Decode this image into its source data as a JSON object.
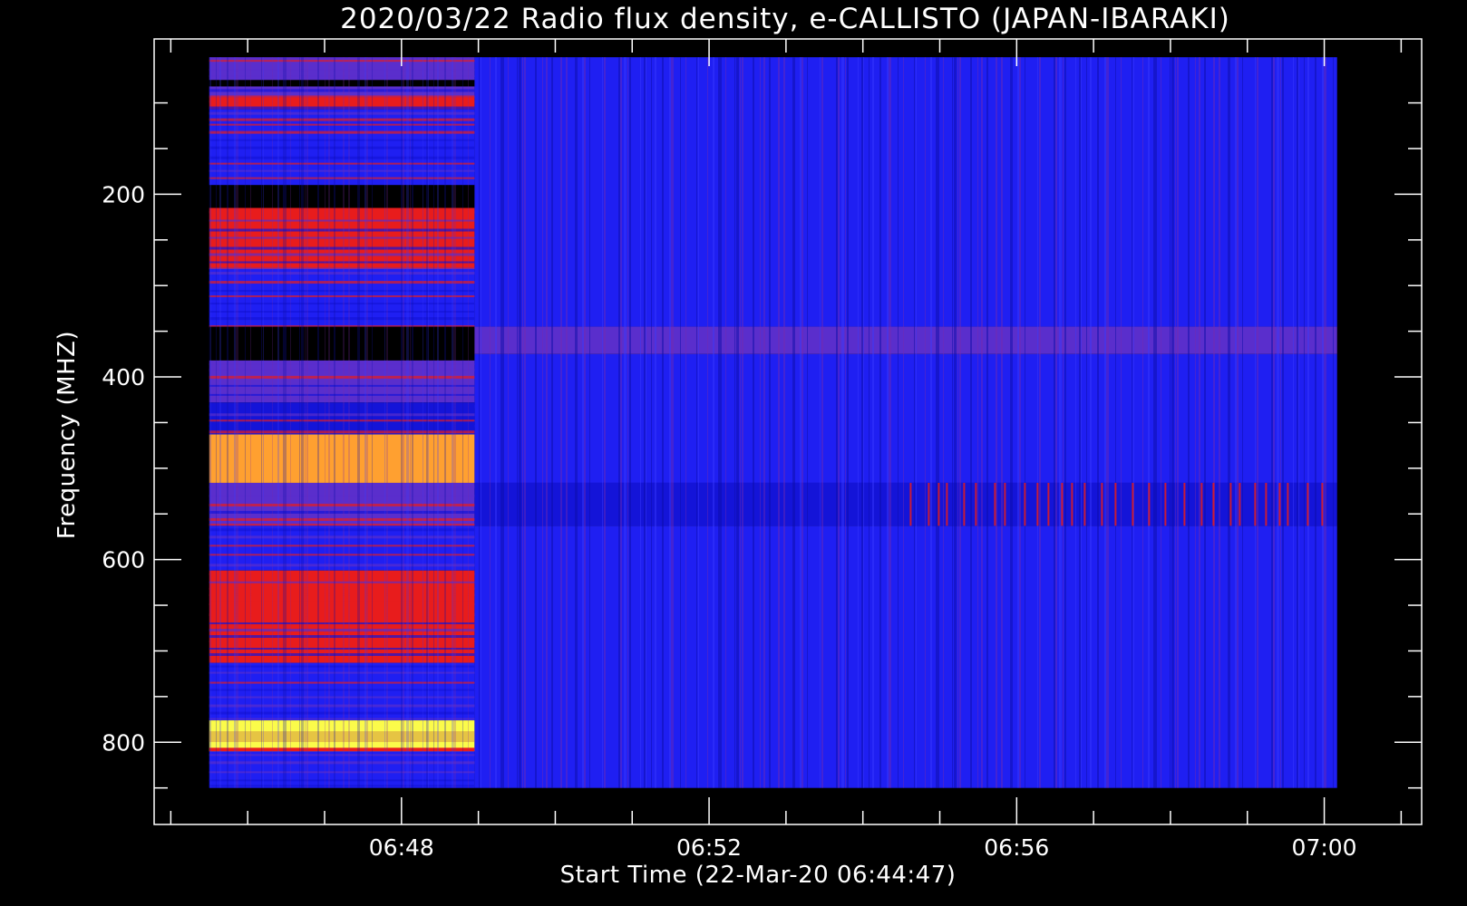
{
  "chart_data": {
    "type": "heatmap",
    "title": "2020/03/22  Radio flux density, e-CALLISTO (JAPAN-IBARAKI)",
    "xlabel": "Start Time (22-Mar-20 06:44:47)",
    "ylabel": "Frequency (MHZ)",
    "x_start": "06:44:47",
    "x_data_range": [
      "06:45:30",
      "07:00:10"
    ],
    "xlim": [
      "06:44:47",
      "07:01:16"
    ],
    "ylim": [
      30,
      890
    ],
    "y_data_range": [
      50,
      850
    ],
    "y_inverted": true,
    "xticks": [
      "06:48",
      "06:52",
      "06:56",
      "07:00"
    ],
    "yticks": [
      200,
      400,
      600,
      800
    ],
    "grid": false,
    "colors": {
      "background": "#000000",
      "base": "#1f1ff2",
      "base_dark": "#1414d8",
      "mid": "#5a2ecc",
      "red": "#e81c1c",
      "orange": "#ffa030",
      "yellow": "#fbfb4a",
      "gap": "#000000"
    },
    "segments": [
      {
        "time_range": [
          "06:45:30",
          "06:48:57"
        ],
        "bands": [
          {
            "freq_range": [
              50,
              75
            ],
            "level": "mid"
          },
          {
            "freq_range": [
              75,
              82
            ],
            "level": "gap"
          },
          {
            "freq_range": [
              82,
              94
            ],
            "level": "mid"
          },
          {
            "freq_range": [
              94,
              107
            ],
            "level": "red"
          },
          {
            "freq_range": [
              107,
              190
            ],
            "level": "base"
          },
          {
            "freq_range": [
              190,
              215
            ],
            "level": "gap"
          },
          {
            "freq_range": [
              215,
              282
            ],
            "level": "red"
          },
          {
            "freq_range": [
              282,
              345
            ],
            "level": "base"
          },
          {
            "freq_range": [
              345,
              382
            ],
            "level": "gap"
          },
          {
            "freq_range": [
              382,
              428
            ],
            "level": "mid"
          },
          {
            "freq_range": [
              428,
              463
            ],
            "level": "base_dark"
          },
          {
            "freq_range": [
              463,
              516
            ],
            "level": "orange"
          },
          {
            "freq_range": [
              516,
              563
            ],
            "level": "mid"
          },
          {
            "freq_range": [
              563,
              612
            ],
            "level": "base"
          },
          {
            "freq_range": [
              612,
              645
            ],
            "level": "red"
          },
          {
            "freq_range": [
              645,
              713
            ],
            "level": "red"
          },
          {
            "freq_range": [
              713,
              776
            ],
            "level": "base"
          },
          {
            "freq_range": [
              776,
              810
            ],
            "level": "yellow"
          },
          {
            "freq_range": [
              810,
              850
            ],
            "level": "base"
          }
        ]
      },
      {
        "time_range": [
          "06:48:57",
          "07:00:10"
        ],
        "bands": [
          {
            "freq_range": [
              50,
              345
            ],
            "level": "base"
          },
          {
            "freq_range": [
              345,
              375
            ],
            "level": "mid"
          },
          {
            "freq_range": [
              375,
              516
            ],
            "level": "base"
          },
          {
            "freq_range": [
              516,
              563
            ],
            "level": "base_dark"
          },
          {
            "freq_range": [
              563,
              850
            ],
            "level": "base"
          }
        ]
      }
    ]
  }
}
